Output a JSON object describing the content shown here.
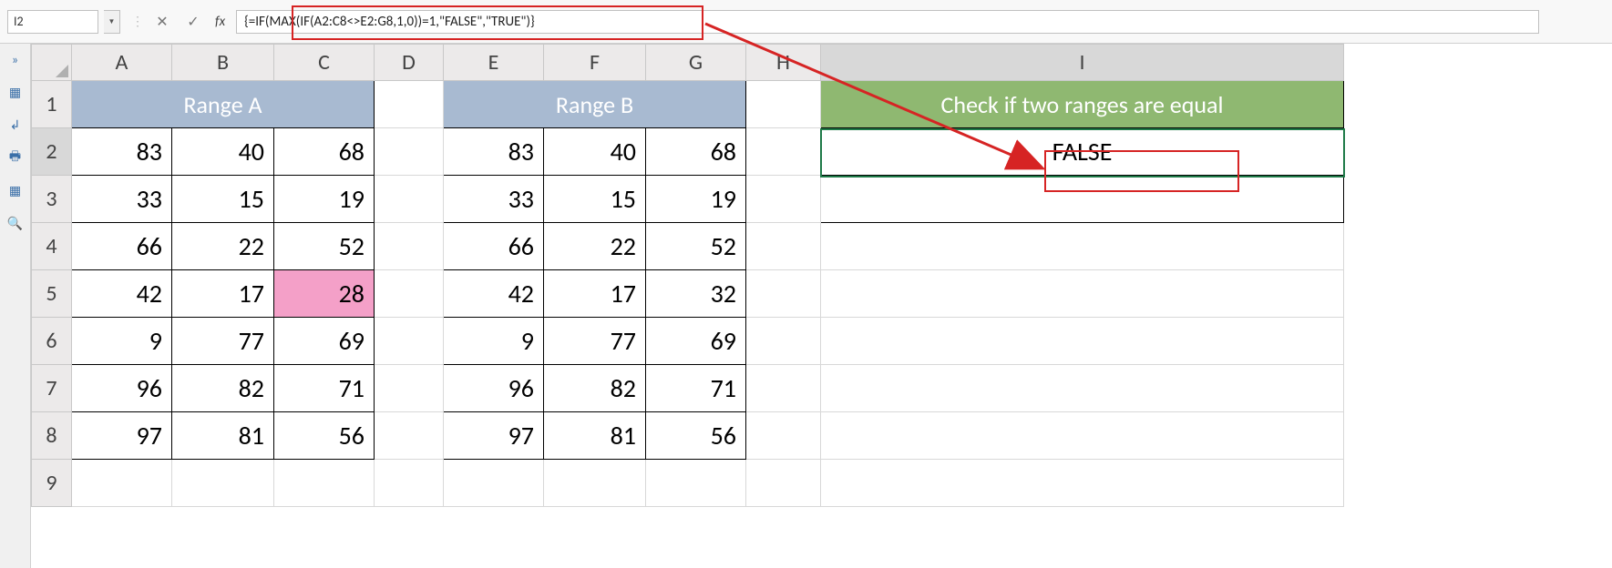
{
  "name_box": "I2",
  "formula": "{=IF(MAX(IF(A2:C8<>E2:G8,1,0))=1,\"FALSE\",\"TRUE\")}",
  "columns": [
    "A",
    "B",
    "C",
    "D",
    "E",
    "F",
    "G",
    "H",
    "I"
  ],
  "rows": [
    "1",
    "2",
    "3",
    "4",
    "5",
    "6",
    "7",
    "8",
    "9"
  ],
  "range_a_header": "Range A",
  "range_b_header": "Range B",
  "check_header": "Check if two ranges are equal",
  "result_value": "FALSE",
  "range_a": [
    [
      83,
      40,
      68
    ],
    [
      33,
      15,
      19
    ],
    [
      66,
      22,
      52
    ],
    [
      42,
      17,
      28
    ],
    [
      9,
      77,
      69
    ],
    [
      96,
      82,
      71
    ],
    [
      97,
      81,
      56
    ]
  ],
  "range_b": [
    [
      83,
      40,
      68
    ],
    [
      33,
      15,
      19
    ],
    [
      66,
      22,
      52
    ],
    [
      42,
      17,
      32
    ],
    [
      9,
      77,
      69
    ],
    [
      96,
      82,
      71
    ],
    [
      97,
      81,
      56
    ]
  ],
  "side_icons": [
    "»",
    "▦",
    "↲",
    "🖶",
    "▦",
    "🔍"
  ]
}
